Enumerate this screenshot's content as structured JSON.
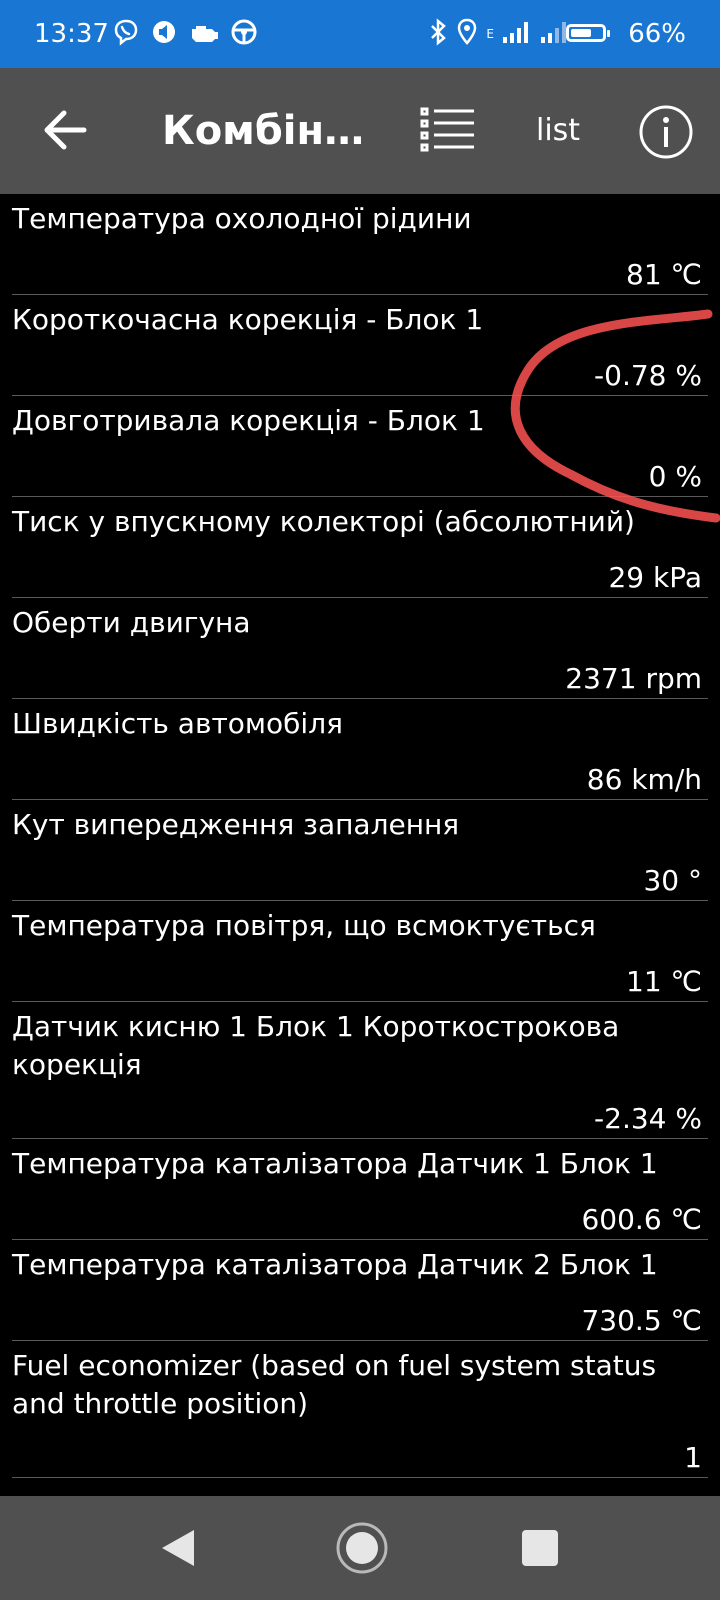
{
  "status_bar": {
    "time": "13:37",
    "battery_percent": "66%",
    "battery_level": 0.66,
    "network_label": "E",
    "icons": [
      "viber-icon",
      "media-icon",
      "car-engine-icon",
      "steering-wheel-icon",
      "bluetooth-icon",
      "location-icon",
      "signal-icon",
      "signal-icon-2",
      "battery-icon"
    ]
  },
  "app_bar": {
    "title": "Комбіно…",
    "list_label": "list",
    "icons": [
      "back-arrow-icon",
      "list-icon",
      "info-icon"
    ]
  },
  "rows": [
    {
      "label": "Температура охолодної рідини",
      "value": "81 ℃"
    },
    {
      "label": "Короткочасна корекція - Блок 1",
      "value": "-0.78 %"
    },
    {
      "label": "Довготривала корекція - Блок 1",
      "value": "0 %"
    },
    {
      "label": "Тиск у впускному колекторі (абсолютний)",
      "value": "29 kPa"
    },
    {
      "label": "Оберти двигуна",
      "value": "2371 rpm"
    },
    {
      "label": "Швидкість автомобіля",
      "value": "86 km/h"
    },
    {
      "label": "Кут випередження запалення",
      "value": "30 °"
    },
    {
      "label": "Температура повітря, що всмоктується",
      "value": "11 ℃"
    },
    {
      "label": "Датчик кисню 1 Блок 1 Короткострокова корекція",
      "value": "-2.34 %"
    },
    {
      "label": "Температура каталізатора Датчик 1 Блок 1",
      "value": "600.6 ℃"
    },
    {
      "label": "Температура каталізатора Датчик 2 Блок 1",
      "value": "730.5 ℃"
    },
    {
      "label": "Fuel economizer (based on fuel system status and throttle position)",
      "value": "1"
    }
  ],
  "annotation_color": "#ff5252",
  "nav_bar": {
    "icons": [
      "nav-back-icon",
      "nav-home-icon",
      "nav-recents-icon"
    ]
  }
}
